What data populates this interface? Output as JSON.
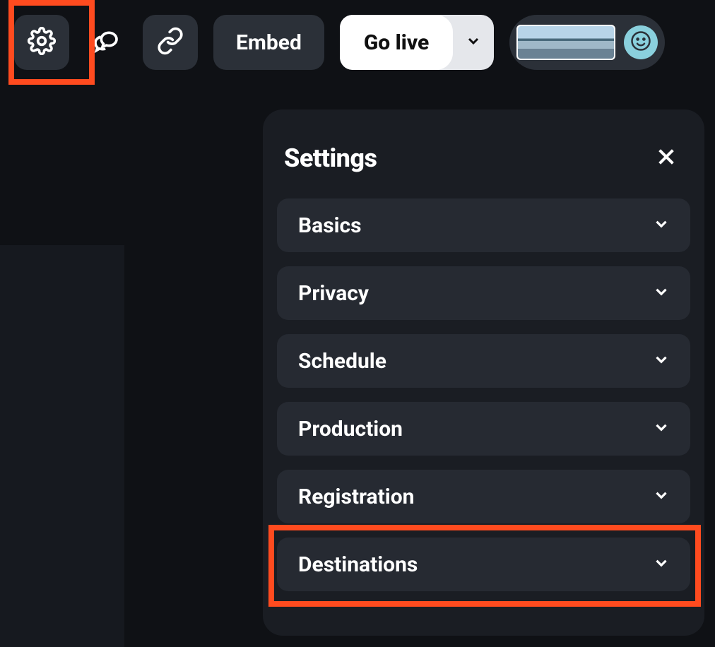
{
  "toolbar": {
    "embed_label": "Embed",
    "golive_label": "Go live"
  },
  "settings": {
    "title": "Settings",
    "items": [
      {
        "label": "Basics"
      },
      {
        "label": "Privacy"
      },
      {
        "label": "Schedule"
      },
      {
        "label": "Production"
      },
      {
        "label": "Registration"
      },
      {
        "label": "Destinations"
      }
    ]
  },
  "highlights": {
    "settings_button": true,
    "destinations_row": true
  }
}
